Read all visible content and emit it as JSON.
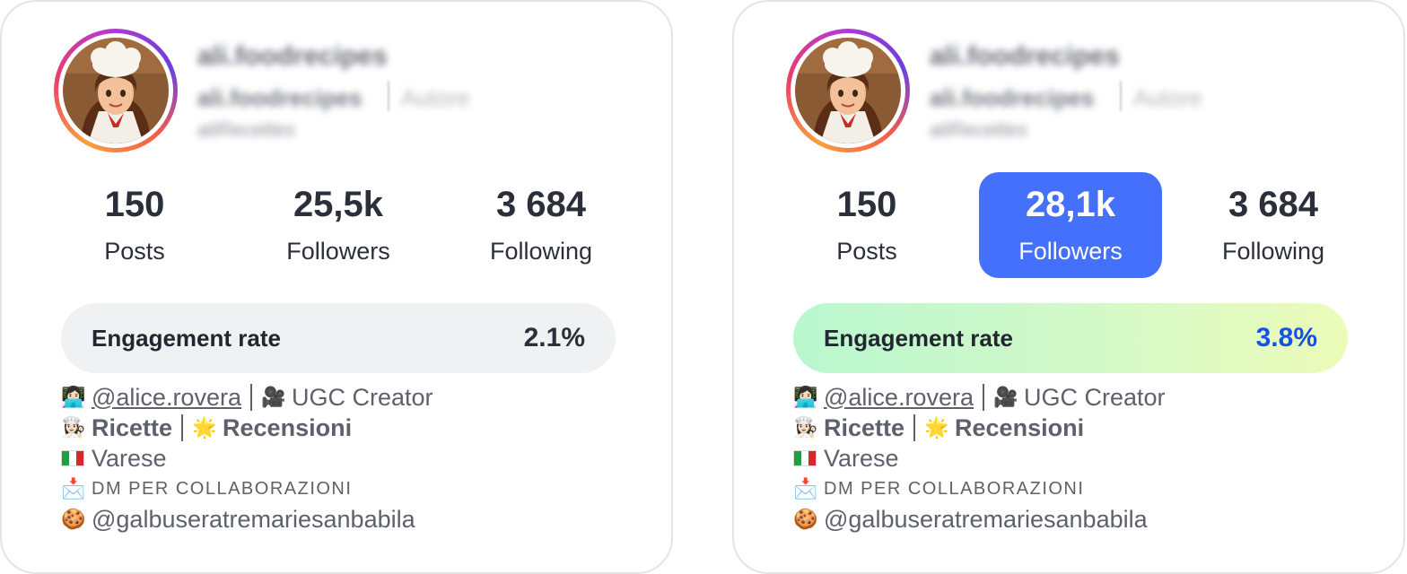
{
  "colors": {
    "accent": "#4470fb",
    "engagement_low_bg": "#f0f1f3",
    "engagement_high_value": "#1651e6"
  },
  "profiles": [
    {
      "username": "ali.foodrecipes",
      "handle": "ali.foodrecipes",
      "category": "Autore",
      "subline": "aliRecettes",
      "stats": [
        {
          "value": "150",
          "label": "Posts"
        },
        {
          "value": "25,5k",
          "label": "Followers"
        },
        {
          "value": "3 684",
          "label": "Following"
        }
      ],
      "engagement": {
        "label": "Engagement rate",
        "value": "2.1%"
      },
      "bio": {
        "line1_emoji": "👩🏻‍💻",
        "mention": "@alice.rovera",
        "line1_emoji2": "🎥",
        "role": "UGC Creator",
        "line2_emoji": "👩🏻‍🍳",
        "ricette": "Ricette",
        "line2_emoji2": "🌟",
        "recensioni": "Recensioni",
        "city": "Varese",
        "line4_emoji": "📩",
        "dm": "DM PER COLLABORAZIONI",
        "line5_emoji": "🍪",
        "partner": "@galbuseratremariesanbabila"
      }
    },
    {
      "username": "ali.foodrecipes",
      "handle": "ali.foodrecipes",
      "category": "Autore",
      "subline": "aliRecettes",
      "stats": [
        {
          "value": "150",
          "label": "Posts"
        },
        {
          "value": "28,1k",
          "label": "Followers"
        },
        {
          "value": "3 684",
          "label": "Following"
        }
      ],
      "engagement": {
        "label": "Engagement rate",
        "value": "3.8%"
      },
      "bio": {
        "line1_emoji": "👩🏻‍💻",
        "mention": "@alice.rovera",
        "line1_emoji2": "🎥",
        "role": "UGC Creator",
        "line2_emoji": "👩🏻‍🍳",
        "ricette": "Ricette",
        "line2_emoji2": "🌟",
        "recensioni": "Recensioni",
        "city": "Varese",
        "line4_emoji": "📩",
        "dm": "DM PER COLLABORAZIONI",
        "line5_emoji": "🍪",
        "partner": "@galbuseratremariesanbabila"
      }
    }
  ]
}
